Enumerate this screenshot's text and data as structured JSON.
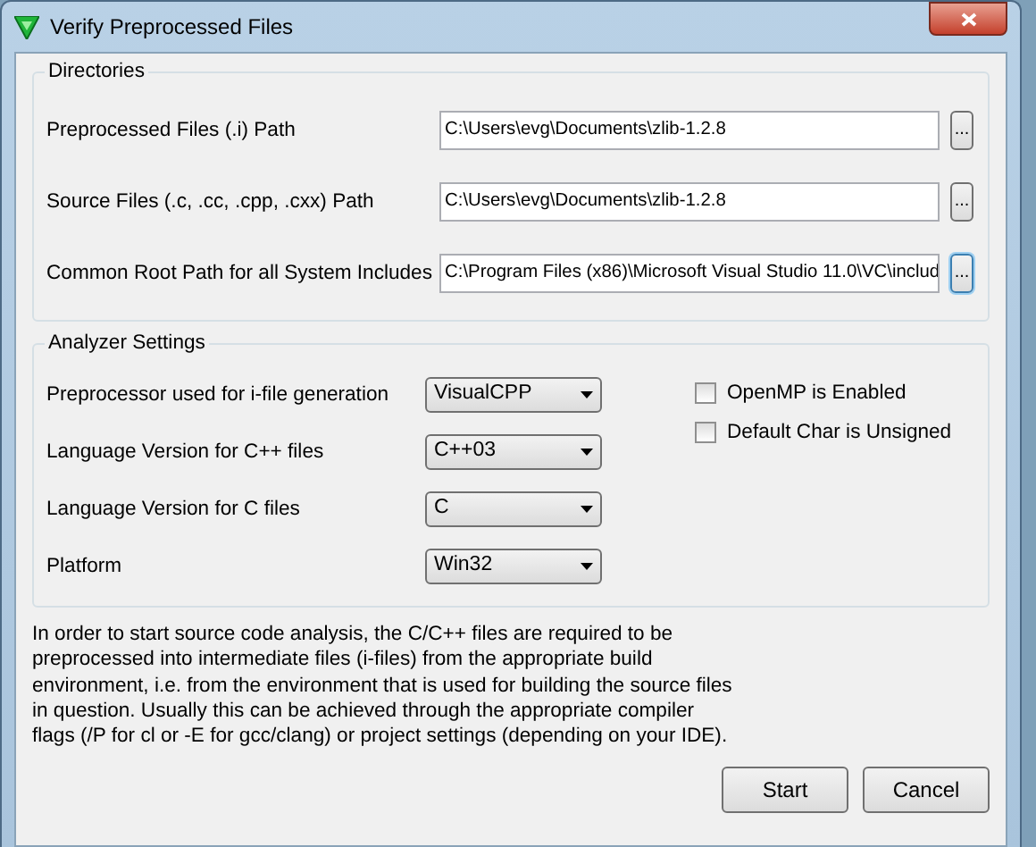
{
  "window": {
    "title": "Verify Preprocessed Files"
  },
  "directories": {
    "legend": "Directories",
    "rows": [
      {
        "label": "Preprocessed Files (.i) Path",
        "value": "C:\\Users\\evg\\Documents\\zlib-1.2.8",
        "browse": "...",
        "focused": false
      },
      {
        "label": "Source Files (.c, .cc, .cpp, .cxx) Path",
        "value": "C:\\Users\\evg\\Documents\\zlib-1.2.8",
        "browse": "...",
        "focused": false
      },
      {
        "label": "Common Root Path for all System Includes",
        "value": "C:\\Program Files (x86)\\Microsoft Visual Studio 11.0\\VC\\includ",
        "browse": "...",
        "focused": true
      }
    ]
  },
  "analyzer": {
    "legend": "Analyzer Settings",
    "selects": [
      {
        "label": "Preprocessor used for i-file generation",
        "value": "VisualCPP"
      },
      {
        "label": "Language Version for C++ files",
        "value": "C++03"
      },
      {
        "label": "Language Version for C files",
        "value": "C"
      },
      {
        "label": "Platform",
        "value": "Win32"
      }
    ],
    "checkboxes": [
      {
        "label": "OpenMP is Enabled",
        "checked": false
      },
      {
        "label": "Default Char is Unsigned",
        "checked": false
      }
    ]
  },
  "note": "In order to start source code analysis, the C/C++ files are required to be preprocessed into intermediate files (i-files) from the appropriate build environment, i.e. from the environment that is used for building the source files in question. Usually this can be achieved through the appropriate compiler flags (/P for cl or -E for gcc/clang) or project settings (depending on your IDE).",
  "buttons": [
    {
      "label": "Start"
    },
    {
      "label": "Cancel"
    }
  ]
}
